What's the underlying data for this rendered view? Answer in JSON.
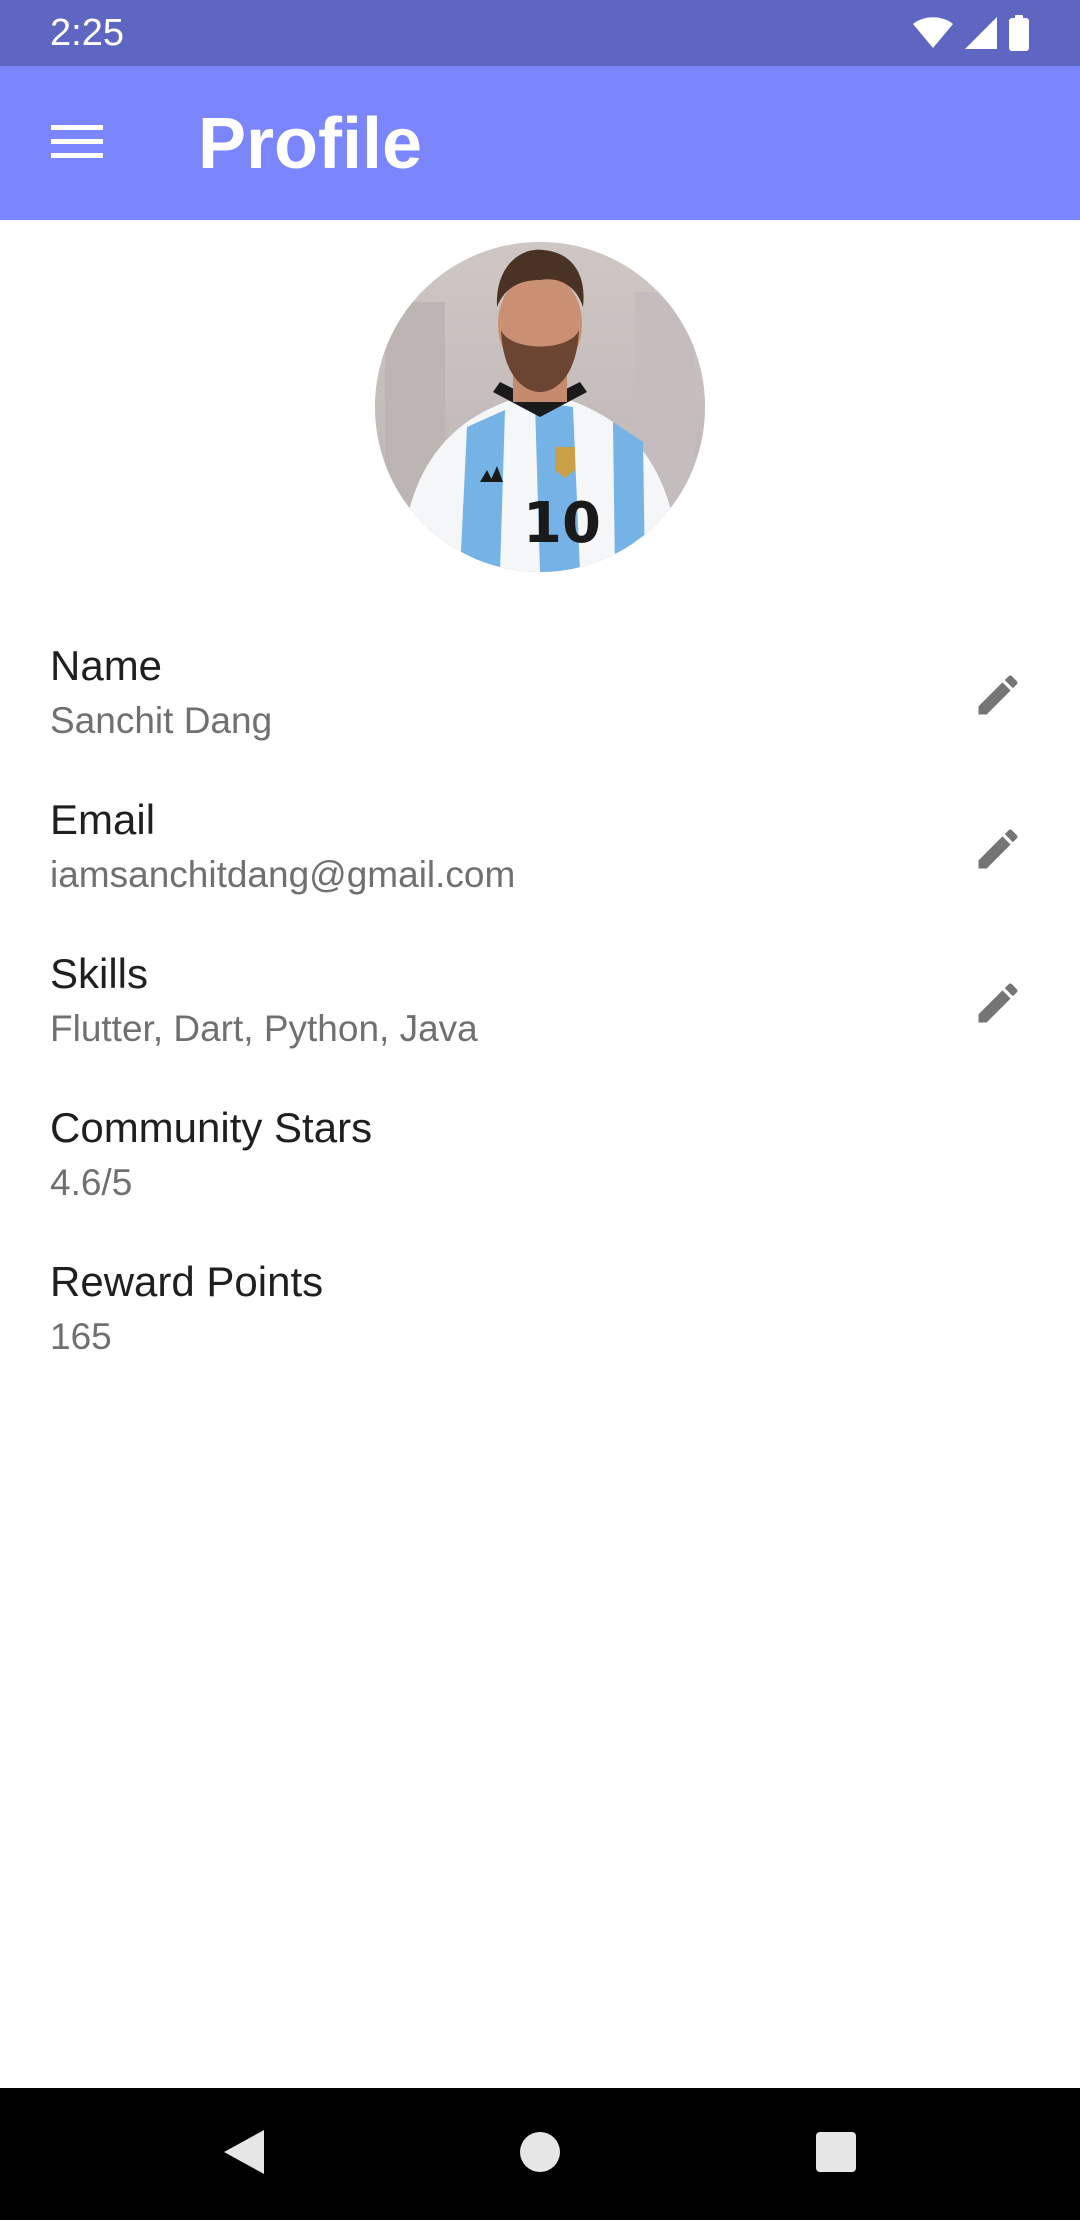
{
  "status_bar": {
    "time": "2:25",
    "icons": [
      "wifi-icon",
      "signal-icon",
      "battery-icon"
    ],
    "background": "#5f66c2"
  },
  "app_bar": {
    "title": "Profile",
    "menu_icon": "menu-icon",
    "background": "#7b86fd"
  },
  "profile": {
    "avatar": "profile-photo",
    "fields": [
      {
        "label": "Name",
        "value": "Sanchit Dang",
        "editable": true
      },
      {
        "label": "Email",
        "value": "iamsanchitdang@gmail.com",
        "editable": true
      },
      {
        "label": "Skills",
        "value": "Flutter, Dart, Python, Java",
        "editable": true
      },
      {
        "label": "Community Stars",
        "value": "4.6/5",
        "editable": false
      },
      {
        "label": "Reward Points",
        "value": "165",
        "editable": false
      }
    ]
  },
  "nav_bar": {
    "buttons": [
      "back-icon",
      "home-icon",
      "recents-icon"
    ]
  }
}
